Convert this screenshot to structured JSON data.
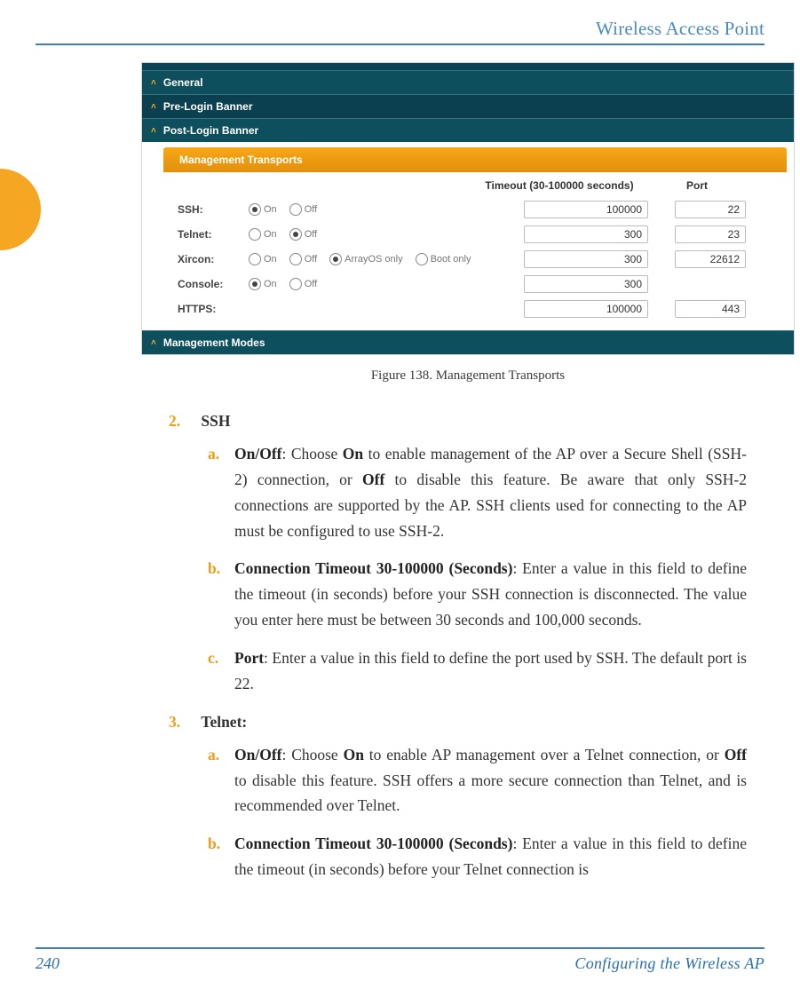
{
  "header": {
    "title": "Wireless Access Point"
  },
  "footer": {
    "page": "240",
    "chapter": "Configuring the Wireless AP"
  },
  "figure": {
    "caption": "Figure 138. Management Transports",
    "accordions": {
      "general": "General",
      "pre": "Pre-Login Banner",
      "post": "Post-Login Banner",
      "modes": "Management Modes"
    },
    "panel_title": "Management Transports",
    "columns": {
      "timeout": "Timeout (30-100000 seconds)",
      "port": "Port"
    },
    "radio_labels": {
      "on": "On",
      "off": "Off",
      "arrayos": "ArrayOS only",
      "boot": "Boot only"
    },
    "rows": [
      {
        "label": "SSH:",
        "selected": "on",
        "extra": false,
        "timeout": "100000",
        "port": "22"
      },
      {
        "label": "Telnet:",
        "selected": "off",
        "extra": false,
        "timeout": "300",
        "port": "23"
      },
      {
        "label": "Xircon:",
        "selected": "arrayos",
        "extra": true,
        "timeout": "300",
        "port": "22612"
      },
      {
        "label": "Console:",
        "selected": "on",
        "extra": false,
        "timeout": "300",
        "port": ""
      },
      {
        "label": "HTTPS:",
        "selected": "",
        "extra": false,
        "noopts": true,
        "timeout": "100000",
        "port": "443"
      }
    ]
  },
  "body": {
    "item2": {
      "num": "2.",
      "title": "SSH",
      "a": {
        "lbl": "a.",
        "lead": "On/Off",
        "text": ": Choose ",
        "bold1": "On",
        "text2": " to enable management of the AP over a Secure Shell (SSH-2) connection, or ",
        "bold2": "Off",
        "text3": " to disable this feature. Be aware that only SSH-2 connections are supported by the AP. SSH clients used for connecting to the AP must be configured to use SSH-2."
      },
      "b": {
        "lbl": "b.",
        "lead": "Connection Timeout 30-100000 (Seconds)",
        "text": ": Enter a value in this field to define the timeout (in seconds) before your SSH connection is disconnected. The value you enter here must be between 30 seconds and 100,000 seconds."
      },
      "c": {
        "lbl": "c.",
        "lead": "Port",
        "text": ": Enter a value in this field to define the port used by SSH. The default port is 22."
      }
    },
    "item3": {
      "num": "3.",
      "title": "Telnet:",
      "a": {
        "lbl": "a.",
        "lead": "On/Off",
        "text": ": Choose ",
        "bold1": "On",
        "text2": " to enable AP management over a Telnet connection, or ",
        "bold2": "Off",
        "text3": " to disable this feature. SSH offers a more secure connection than Telnet, and is recommended over Telnet."
      },
      "b": {
        "lbl": "b.",
        "lead": "Connection Timeout 30-100000 (Seconds)",
        "text": ": Enter a value in this field to define the timeout (in seconds) before your Telnet connection is"
      }
    }
  }
}
